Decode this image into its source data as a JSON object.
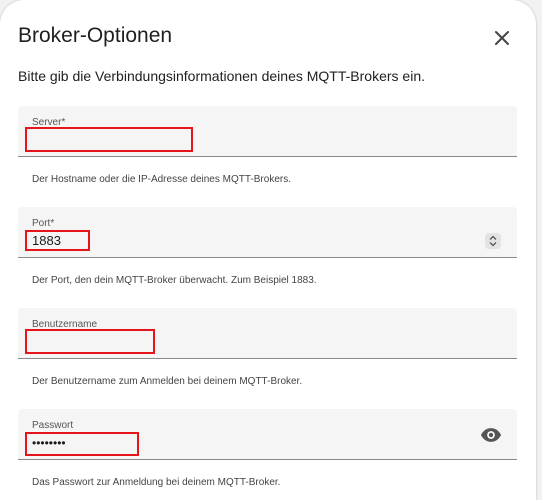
{
  "dialog": {
    "title": "Broker-Optionen",
    "intro": "Bitte gib die Verbindungsinformationen deines MQTT-Brokers ein."
  },
  "icons": {
    "close": "close-icon",
    "spinner": "number-spinner-icon",
    "visibility": "eye-icon"
  },
  "fields": {
    "server": {
      "label": "Server*",
      "value": "",
      "helper": "Der Hostname oder die IP-Adresse deines MQTT-Brokers."
    },
    "port": {
      "label": "Port*",
      "value": "1883",
      "helper": "Der Port, den dein MQTT-Broker überwacht. Zum Beispiel 1883."
    },
    "username": {
      "label": "Benutzername",
      "value": "",
      "helper": "Der Benutzername zum Anmelden bei deinem MQTT-Broker."
    },
    "password": {
      "label": "Passwort",
      "value": "••••••••",
      "helper": "Das Passwort zur Anmeldung bei deinem MQTT-Broker."
    }
  },
  "colors": {
    "highlight": "#e8141c",
    "field_background": "#f5f5f5"
  }
}
